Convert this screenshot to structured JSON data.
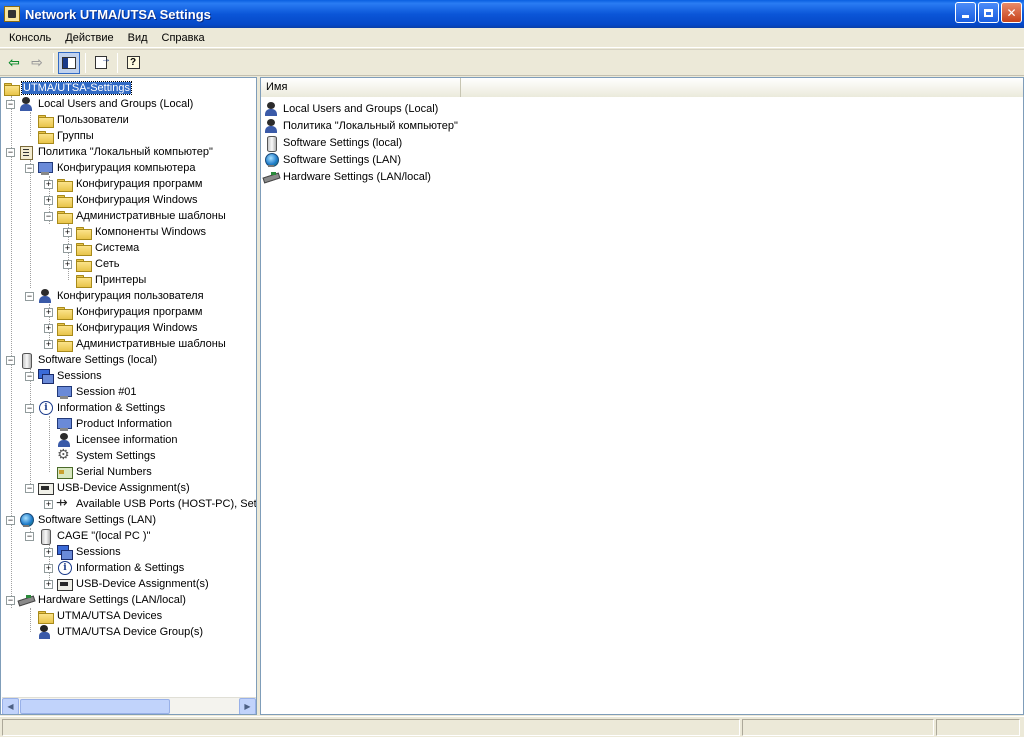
{
  "window": {
    "title": "Network UTMA/UTSA Settings"
  },
  "menu": [
    "Консоль",
    "Действие",
    "Вид",
    "Справка"
  ],
  "toolbar": {
    "buttons": [
      "back-arrow-icon",
      "forward-arrow-icon",
      "show-hide-tree-icon",
      "export-list-icon",
      "help-icon"
    ]
  },
  "tree": {
    "root": "UTMA/UTSA-Settings",
    "items": [
      {
        "label": "Local Users and Groups (Local)",
        "icon": "users-icon"
      },
      {
        "label": "Пользователи",
        "icon": "folder-icon"
      },
      {
        "label": "Группы",
        "icon": "folder-icon"
      },
      {
        "label": "Политика \"Локальный компьютер\"",
        "icon": "policy-icon"
      },
      {
        "label": "Конфигурация компьютера",
        "icon": "computer-icon"
      },
      {
        "label": "Конфигурация программ",
        "icon": "folder-icon"
      },
      {
        "label": "Конфигурация Windows",
        "icon": "folder-icon"
      },
      {
        "label": "Административные шаблоны",
        "icon": "folder-icon"
      },
      {
        "label": "Компоненты Windows",
        "icon": "folder-icon"
      },
      {
        "label": "Система",
        "icon": "folder-icon"
      },
      {
        "label": "Сеть",
        "icon": "folder-icon"
      },
      {
        "label": "Принтеры",
        "icon": "folder-icon"
      },
      {
        "label": "Конфигурация пользователя",
        "icon": "user-config-icon"
      },
      {
        "label": "Конфигурация программ",
        "icon": "folder-icon"
      },
      {
        "label": "Конфигурация Windows",
        "icon": "folder-icon"
      },
      {
        "label": "Административные шаблоны",
        "icon": "folder-icon"
      },
      {
        "label": "Software Settings (local)",
        "icon": "disk-icon"
      },
      {
        "label": "Sessions",
        "icon": "sessions-icon"
      },
      {
        "label": "Session #01",
        "icon": "session-icon"
      },
      {
        "label": "Information & Settings",
        "icon": "info-icon"
      },
      {
        "label": "Product Information",
        "icon": "product-info-icon"
      },
      {
        "label": "Licensee information",
        "icon": "licensee-icon"
      },
      {
        "label": "System Settings",
        "icon": "gear-icon"
      },
      {
        "label": "Serial Numbers",
        "icon": "serial-icon"
      },
      {
        "label": "USB-Device Assignment(s)",
        "icon": "usb-device-icon"
      },
      {
        "label": "Available USB Ports (HOST-PC), Sett",
        "icon": "usb-port-icon"
      },
      {
        "label": "Software Settings (LAN)",
        "icon": "globe-icon"
      },
      {
        "label": "CAGE \"(local PC )\"",
        "icon": "disk-icon"
      },
      {
        "label": "Sessions",
        "icon": "sessions-icon"
      },
      {
        "label": "Information & Settings",
        "icon": "info-icon"
      },
      {
        "label": "USB-Device Assignment(s)",
        "icon": "usb-device-icon"
      },
      {
        "label": "Hardware Settings (LAN/local)",
        "icon": "hardware-icon"
      },
      {
        "label": "UTMA/UTSA Devices",
        "icon": "folder-icon"
      },
      {
        "label": "UTMA/UTSA Device Group(s)",
        "icon": "device-group-icon"
      }
    ]
  },
  "list": {
    "column": "Имя",
    "rows": [
      {
        "label": "Local Users and Groups (Local)",
        "icon": "users-icon"
      },
      {
        "label": "Политика \"Локальный компьютер\"",
        "icon": "policy-icon"
      },
      {
        "label": "Software Settings (local)",
        "icon": "disk-icon"
      },
      {
        "label": "Software Settings (LAN)",
        "icon": "globe-icon"
      },
      {
        "label": "Hardware Settings (LAN/local)",
        "icon": "hardware-icon"
      }
    ]
  },
  "colors": {
    "titlebar": "#0b56d8",
    "selection": "#316ac5",
    "chrome": "#ece9d8"
  }
}
